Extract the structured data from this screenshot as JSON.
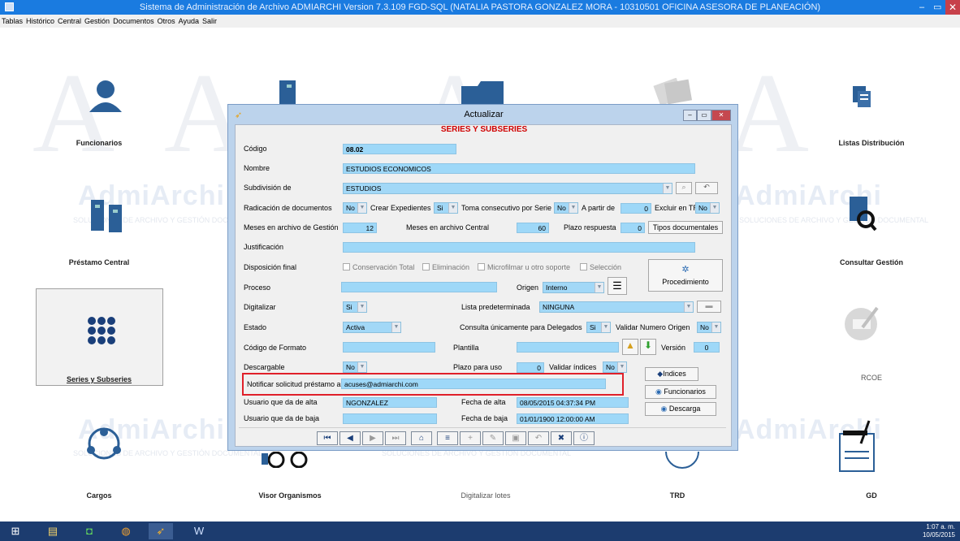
{
  "window": {
    "title": "Sistema de Administración de Archivo ADMIARCHI Version 7.3.109 FGD-SQL (NATALIA PASTORA GONZALEZ MORA - 10310501 OFICINA ASESORA DE PLANEACIÓN)",
    "min": "–",
    "max": "▭",
    "close": "✕"
  },
  "menu": [
    "Tablas",
    "Histórico",
    "Central",
    "Gestión",
    "Documentos",
    "Otros",
    "Ayuda",
    "Salir"
  ],
  "desktop": {
    "funcionarios": "Funcionarios",
    "listas": "Listas Distribución",
    "prestamo": "Préstamo Central",
    "consultar": "Consultar Gestión",
    "series": "Series y Subseries",
    "rcoe": "RCOE",
    "cargos": "Cargos",
    "visor": "Visor Organismos",
    "digitalizar": "Digitalizar lotes",
    "trd": "TRD",
    "gd": "GD",
    "watermark": "AdmiArchi",
    "watermark_sub": "SOLUCIONES DE ARCHIVO Y GESTIÓN DOCUMENTAL"
  },
  "dialog": {
    "title": "Actualizar",
    "subtitle": "SERIES Y SUBSERIES",
    "labels": {
      "codigo": "Código",
      "nombre": "Nombre",
      "subdivision": "Subdivisión de",
      "radicacion": "Radicación de documentos",
      "crear": "Crear Expedientes",
      "toma": "Toma consecutivo por Serie",
      "apartir": "A partir de",
      "excluir": "Excluir en TRD",
      "meses_gestion": "Meses en archivo de Gestión",
      "meses_central": "Meses en archivo Central",
      "plazo": "Plazo respuesta",
      "justificacion": "Justificación",
      "disposicion": "Disposición final",
      "proceso": "Proceso",
      "origen": "Origen",
      "digitalizar": "Digitalizar",
      "lista": "Lista predeterminada",
      "estado": "Estado",
      "consulta": "Consulta únicamente para Delegados",
      "validar": "Validar Numero Origen",
      "codigo_formato": "Código de Formato",
      "plantilla": "Plantilla",
      "version": "Versión",
      "descargable": "Descargable",
      "plazo_uso": "Plazo para uso",
      "validar_indices": "Validar índices",
      "notificar": "Notificar solicitud préstamo a",
      "usuario_alta": "Usuario que da de alta",
      "fecha_alta": "Fecha de alta",
      "usuario_baja": "Usuario que da de baja",
      "fecha_baja": "Fecha de baja"
    },
    "values": {
      "codigo": "08.02",
      "nombre": "ESTUDIOS ECONOMICOS",
      "subdivision": "ESTUDIOS",
      "radicacion": "No",
      "crear": "Si",
      "toma": "No",
      "apartir": "0",
      "excluir": "No",
      "meses_gestion": "12",
      "meses_central": "60",
      "plazo": "0",
      "justificacion": "",
      "proceso": "",
      "origen": "Interno",
      "digitalizar": "Si",
      "lista": "NINGUNA",
      "estado": "Activa",
      "consulta": "Si",
      "validar": "No",
      "codigo_formato": "",
      "plantilla": "",
      "version": "0",
      "descargable": "No",
      "plazo_uso": "0",
      "validar_indices": "No",
      "notificar": "acuses@admiarchi.com",
      "usuario_alta": "NGONZALEZ",
      "fecha_alta": "08/05/2015 04:37:34 PM",
      "usuario_baja": "",
      "fecha_baja": "01/01/1900 12:00:00 AM"
    },
    "checks": {
      "conservacion": "Conservación Total",
      "eliminacion": "Eliminación",
      "microfilmar": "Microfilmar u otro soporte",
      "seleccion": "Selección"
    },
    "buttons": {
      "tipos": "Tipos documentales",
      "procedimiento": "Procedimiento",
      "indices": "Indices",
      "funcionarios": "Funcionarios",
      "descarga": "Descarga"
    }
  },
  "tray": {
    "time": "1:07 a. m.",
    "date": "10/05/2015"
  },
  "colors": {
    "titlebar": "#1a7be0",
    "field": "#9ed8f8",
    "highlight": "#e0202a",
    "taskbar": "#1c3c6f"
  }
}
